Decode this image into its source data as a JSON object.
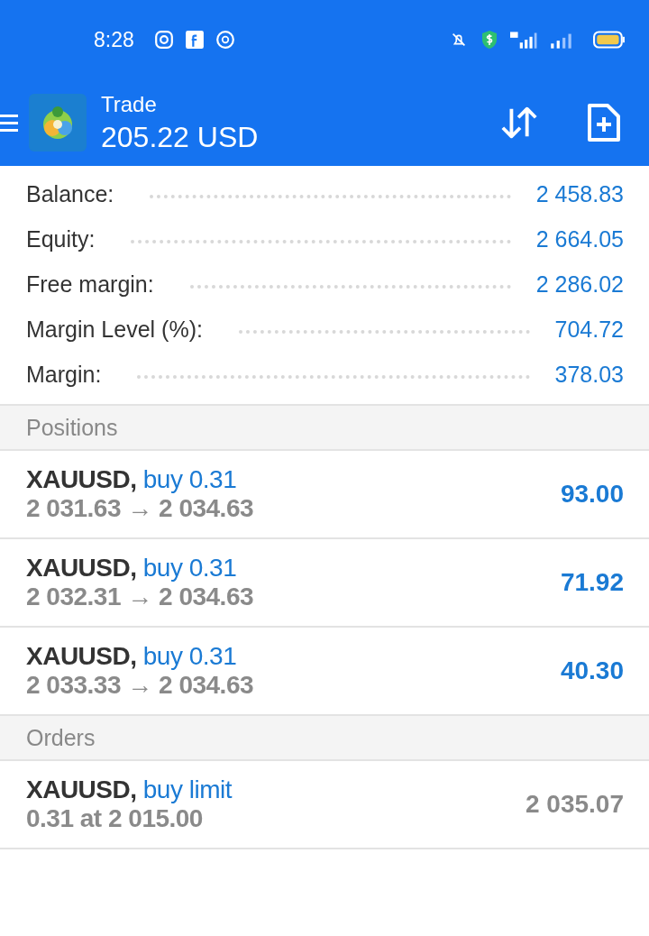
{
  "status_bar": {
    "time": "8:28"
  },
  "header": {
    "title": "Trade",
    "subtitle": "205.22 USD"
  },
  "summary": [
    {
      "label": "Balance:",
      "value": "2 458.83"
    },
    {
      "label": "Equity:",
      "value": "2 664.05"
    },
    {
      "label": "Free margin:",
      "value": "2 286.02"
    },
    {
      "label": "Margin Level (%):",
      "value": "704.72"
    },
    {
      "label": "Margin:",
      "value": "378.03"
    }
  ],
  "positions": {
    "title": "Positions",
    "items": [
      {
        "symbol": "XAUUSD,",
        "side": "buy 0.31",
        "prices": "2 031.63 → 2 034.63",
        "profit": "93.00"
      },
      {
        "symbol": "XAUUSD,",
        "side": "buy 0.31",
        "prices": "2 032.31 → 2 034.63",
        "profit": "71.92"
      },
      {
        "symbol": "XAUUSD,",
        "side": "buy 0.31",
        "prices": "2 033.33 → 2 034.63",
        "profit": "40.30"
      }
    ]
  },
  "orders": {
    "title": "Orders",
    "items": [
      {
        "symbol": "XAUUSD,",
        "side": "buy limit",
        "details": "0.31 at 2 015.00",
        "price": "2 035.07"
      }
    ]
  }
}
